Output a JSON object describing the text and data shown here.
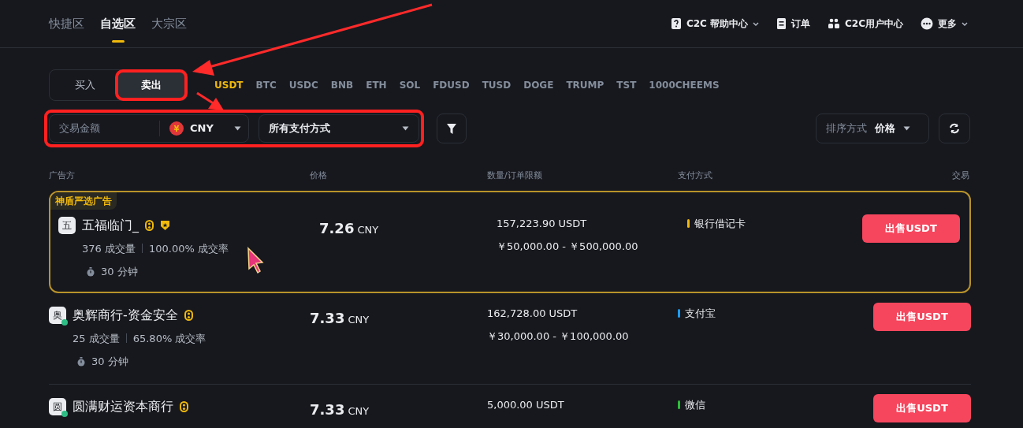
{
  "zone_tabs": [
    {
      "label": "快捷区",
      "selected": false
    },
    {
      "label": "自选区",
      "selected": true
    },
    {
      "label": "大宗区",
      "selected": false
    }
  ],
  "top_nav": [
    {
      "kind": "help",
      "label": "C2C 帮助中心",
      "dropdown": true
    },
    {
      "kind": "orders",
      "label": "订单",
      "dropdown": false
    },
    {
      "kind": "user",
      "label": "C2C用户中心",
      "dropdown": false
    },
    {
      "kind": "more",
      "label": "更多",
      "dropdown": true
    }
  ],
  "side_tabs": [
    {
      "label": "买入",
      "selected": false,
      "highlighted": false
    },
    {
      "label": "卖出",
      "selected": true,
      "highlighted": true
    }
  ],
  "coins": [
    {
      "label": "USDT",
      "selected": true
    },
    {
      "label": "BTC",
      "selected": false
    },
    {
      "label": "USDC",
      "selected": false
    },
    {
      "label": "BNB",
      "selected": false
    },
    {
      "label": "ETH",
      "selected": false
    },
    {
      "label": "SOL",
      "selected": false
    },
    {
      "label": "FDUSD",
      "selected": false
    },
    {
      "label": "TUSD",
      "selected": false
    },
    {
      "label": "DOGE",
      "selected": false
    },
    {
      "label": "TRUMP",
      "selected": false
    },
    {
      "label": "TST",
      "selected": false
    },
    {
      "label": "1000CHEEMS",
      "selected": false
    }
  ],
  "filters": {
    "highlighted": true,
    "amount_placeholder": "交易金额",
    "currency_symbol": "¥",
    "currency": "CNY",
    "payment": "所有支付方式"
  },
  "sort": {
    "label": "排序方式",
    "value": "价格"
  },
  "columns": [
    "广告方",
    "价格",
    "数量/订单限额",
    "支付方式",
    "交易"
  ],
  "rows": [
    {
      "promoted": true,
      "promo_label": "神盾严选广告",
      "avatar": "五",
      "online": false,
      "name": "五福临门_",
      "shield": true,
      "trades": "376 成交量",
      "rate": "100.00% 成交率",
      "time": "30 分钟",
      "price": "7.26",
      "price_unit": "CNY",
      "amount": "157,223.90 USDT",
      "limit": "￥50,000.00 - ￥500,000.00",
      "payment": "银行借记卡",
      "color": "#f0b90b",
      "action": "出售USDT"
    },
    {
      "promoted": false,
      "avatar": "奥",
      "online": true,
      "name": "奥辉商行-资金安全",
      "shield": false,
      "trades": "25 成交量",
      "rate": "65.80% 成交率",
      "time": "30 分钟",
      "price": "7.33",
      "price_unit": "CNY",
      "amount": "162,728.00 USDT",
      "limit": "￥30,000.00 - ￥100,000.00",
      "payment": "支付宝",
      "color": "#1e9bf0",
      "action": "出售USDT"
    },
    {
      "promoted": false,
      "avatar": "圆",
      "online": true,
      "name": "圆满财运资本商行",
      "shield": false,
      "price": "7.33",
      "price_unit": "CNY",
      "amount": "5,000.00 USDT",
      "payment": "微信",
      "color": "#2ebd3a",
      "action": "出售USDT"
    }
  ]
}
